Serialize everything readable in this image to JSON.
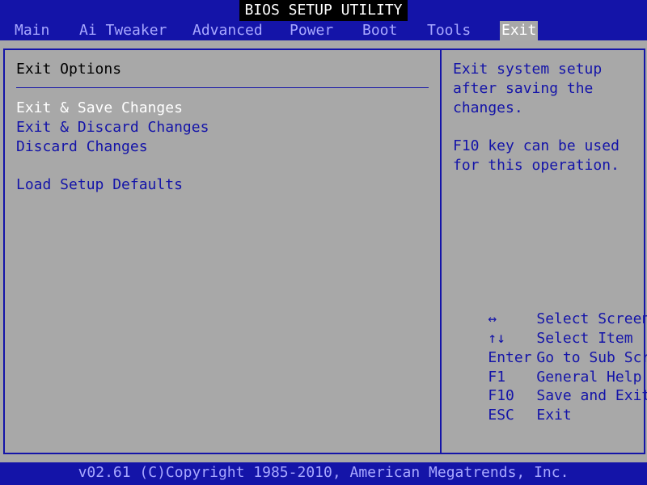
{
  "title": "BIOS SETUP UTILITY",
  "menu": {
    "items": [
      {
        "label": "Main"
      },
      {
        "label": "Ai Tweaker"
      },
      {
        "label": "Advanced"
      },
      {
        "label": "Power"
      },
      {
        "label": "Boot"
      },
      {
        "label": "Tools"
      },
      {
        "label": "Exit"
      }
    ],
    "active": "Exit"
  },
  "main": {
    "section_title": "Exit Options",
    "options": [
      {
        "label": "Exit & Save Changes"
      },
      {
        "label": "Exit & Discard Changes"
      },
      {
        "label": "Discard Changes"
      },
      {
        "label": "Load Setup Defaults"
      }
    ]
  },
  "help": {
    "lines": [
      "Exit system setup",
      "after saving the",
      "changes.",
      "F10 key can be used",
      "for this operation."
    ],
    "keys": [
      {
        "key": "↔",
        "desc": "Select Screen"
      },
      {
        "key": "↑↓",
        "desc": "Select Item"
      },
      {
        "key": "Enter",
        "desc": "Go to Sub Screen"
      },
      {
        "key": "F1",
        "desc": "General Help"
      },
      {
        "key": "F10",
        "desc": "Save and Exit"
      },
      {
        "key": "ESC",
        "desc": "Exit"
      }
    ]
  },
  "footer": "v02.61 (C)Copyright 1985-2010, American Megatrends, Inc.",
  "colors": {
    "background": "#a8a8a8",
    "bar": "#1414a8",
    "selected_text": "#ffffff",
    "option_text": "#1414a8"
  }
}
